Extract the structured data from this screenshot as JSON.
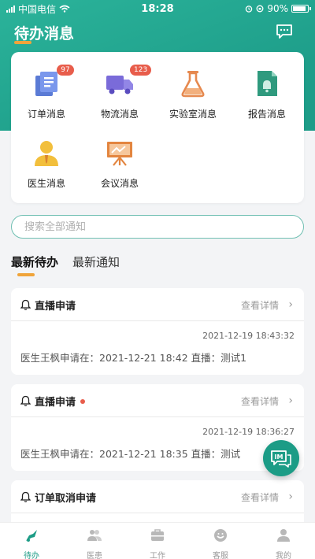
{
  "status_bar": {
    "carrier": "中国电信",
    "time": "18:28",
    "battery": "90%"
  },
  "header": {
    "title": "待办消息",
    "message_icon": "chat-bubble-icon"
  },
  "grid": [
    {
      "label": "订单消息",
      "icon": "order-doc-icon",
      "badge": "97"
    },
    {
      "label": "物流消息",
      "icon": "truck-icon",
      "badge": "123"
    },
    {
      "label": "实验室消息",
      "icon": "flask-icon",
      "badge": ""
    },
    {
      "label": "报告消息",
      "icon": "report-icon",
      "badge": ""
    },
    {
      "label": "医生消息",
      "icon": "doctor-icon",
      "badge": ""
    },
    {
      "label": "会议消息",
      "icon": "presentation-board-icon",
      "badge": ""
    }
  ],
  "search": {
    "placeholder": "搜索全部通知"
  },
  "tabs": [
    {
      "label": "最新待办",
      "active": true
    },
    {
      "label": "最新通知",
      "active": false
    }
  ],
  "cards": [
    {
      "title": "直播申请",
      "unread": false,
      "detail": "查看详情",
      "timestamp": "2021-12-19 18:43:32",
      "body": "医生王枫申请在：2021-12-21 18:42 直播：测试1"
    },
    {
      "title": "直播申请",
      "unread": true,
      "detail": "查看详情",
      "timestamp": "2021-12-19 18:36:27",
      "body": "医生王枫申请在：2021-12-21 18:35 直播：测试"
    },
    {
      "title": "订单取消申请",
      "unread": false,
      "detail": "查看详情",
      "timestamp": "",
      "body": ""
    }
  ],
  "float_button": {
    "label": "IM"
  },
  "tabbar": [
    {
      "label": "待办",
      "icon": "todo-icon",
      "active": true
    },
    {
      "label": "医患",
      "icon": "patients-icon",
      "active": false
    },
    {
      "label": "工作",
      "icon": "briefcase-icon",
      "active": false
    },
    {
      "label": "客服",
      "icon": "customer-service-icon",
      "active": false
    },
    {
      "label": "我的",
      "icon": "profile-icon",
      "active": false
    }
  ],
  "colors": {
    "primary": "#1c9c86",
    "accent": "#f0a43a",
    "badge": "#e85d4b"
  }
}
